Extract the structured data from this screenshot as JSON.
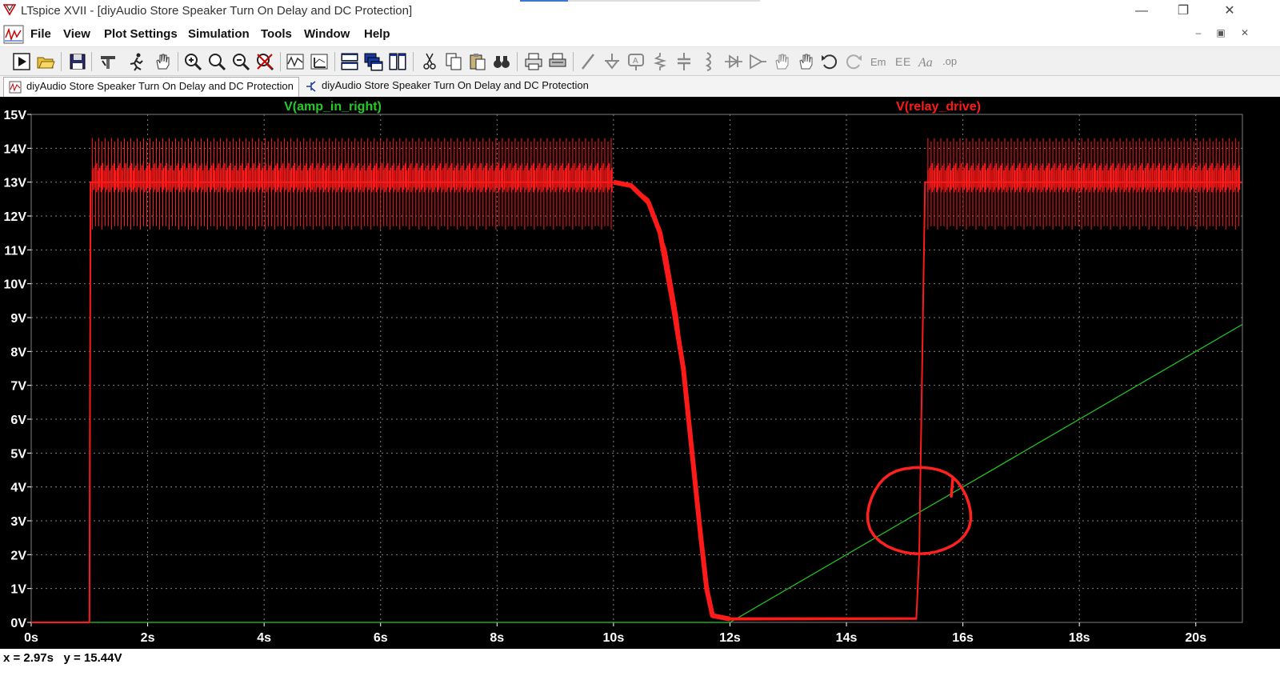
{
  "window": {
    "title": "LTspice XVII - [diyAudio Store Speaker Turn On Delay and DC Protection]",
    "controls": [
      "minimize",
      "restore",
      "close"
    ]
  },
  "menu": [
    {
      "label": "File"
    },
    {
      "label": "View"
    },
    {
      "label": "Plot Settings"
    },
    {
      "label": "Simulation"
    },
    {
      "label": "Tools"
    },
    {
      "label": "Window"
    },
    {
      "label": "Help"
    }
  ],
  "toolbar": [
    "run-icon",
    "open-icon",
    "save-icon",
    "control-panel-icon",
    "run-sim-icon",
    "pan-icon",
    "zoom-in-icon",
    "zoom-fit-icon",
    "zoom-out-icon",
    "zoom-cancel-icon",
    "autorange-icon",
    "chart-icon",
    "tile-h-icon",
    "cascade-icon",
    "tile-v-icon",
    "cut-icon",
    "copy-icon",
    "paste-icon",
    "find-icon",
    "print-icon",
    "print-setup-icon",
    "wire-icon",
    "ground-icon",
    "label-icon",
    "resistor-icon",
    "capacitor-icon",
    "inductor-icon",
    "diode-icon",
    "component-icon",
    "move-icon",
    "drag-icon",
    "undo-icon",
    "redo-icon",
    "rotate-icon",
    "mirror-icon",
    "text-icon",
    "spice-directive-icon"
  ],
  "tabs": [
    {
      "label": "diyAudio Store Speaker Turn On Delay and DC Protection",
      "kind": "waveform",
      "active": true
    },
    {
      "label": "diyAudio Store Speaker Turn On Delay and DC Protection",
      "kind": "schematic",
      "active": false
    }
  ],
  "status": {
    "cursor_readout": "x = 2.97s   y = 15.44V"
  },
  "colors": {
    "background": "#000000",
    "grid": "#808080",
    "axis_text": "#ffffff",
    "trace_green": "#22cc22",
    "trace_red": "#ff1a1a",
    "annotation": "#ff2020"
  },
  "chart_data": {
    "type": "line",
    "title": "",
    "xlabel": "",
    "ylabel": "",
    "xlim": [
      0,
      20.8
    ],
    "ylim": [
      0,
      15
    ],
    "grid": true,
    "legend": "top",
    "x_ticks": [
      "0s",
      "2s",
      "4s",
      "6s",
      "8s",
      "10s",
      "12s",
      "14s",
      "16s",
      "18s",
      "20s"
    ],
    "y_ticks": [
      "0V",
      "1V",
      "2V",
      "3V",
      "4V",
      "5V",
      "6V",
      "7V",
      "8V",
      "9V",
      "10V",
      "11V",
      "12V",
      "13V",
      "14V",
      "15V"
    ],
    "series": [
      {
        "name": "V(amp_in_right)",
        "color": "#22cc22",
        "x": [
          0,
          12.0,
          20.8
        ],
        "y": [
          0,
          0,
          8.8
        ]
      },
      {
        "name": "V(relay_drive)",
        "color": "#ff1a1a",
        "x": [
          0,
          1.0,
          1.02,
          10.0,
          10.3,
          10.6,
          10.9,
          11.1,
          11.3,
          11.5,
          11.6,
          11.7,
          12.0,
          15.2,
          15.25,
          15.35,
          15.5,
          20.8
        ],
        "y": [
          0,
          0,
          13.0,
          13.0,
          12.9,
          12.5,
          11.0,
          9.0,
          6.0,
          2.5,
          1.0,
          0.2,
          0.08,
          0.1,
          2.0,
          13.0,
          13.0,
          13.0
        ],
        "ripple_min": 11.6,
        "ripple_max": 14.3
      }
    ],
    "annotations": [
      {
        "type": "circle",
        "center_x": 15.25,
        "center_y": 3.3,
        "color": "#ff2020"
      }
    ]
  }
}
